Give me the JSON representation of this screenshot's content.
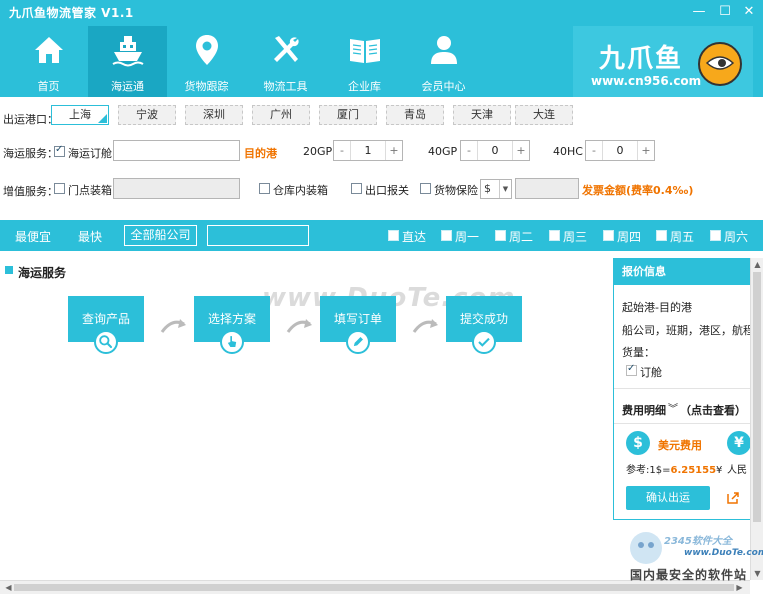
{
  "app": {
    "title": "九爪鱼物流管家 V1.1"
  },
  "window_controls": {
    "minimize": "—",
    "maximize": "☐",
    "close": "✕"
  },
  "nav": [
    {
      "label": "首页",
      "icon": "home-icon"
    },
    {
      "label": "海运通",
      "icon": "ship-icon",
      "active": true
    },
    {
      "label": "货物跟踪",
      "icon": "location-pin-icon"
    },
    {
      "label": "物流工具",
      "icon": "tools-icon"
    },
    {
      "label": "企业库",
      "icon": "book-icon"
    },
    {
      "label": "会员中心",
      "icon": "user-icon"
    }
  ],
  "logo": {
    "name": "九爪鱼",
    "url": "www.cn956.com"
  },
  "ports": {
    "label": "出运港口：",
    "items": [
      "上海",
      "宁波",
      "深圳",
      "广州",
      "厦门",
      "青岛",
      "天津",
      "大连"
    ],
    "selected": "上海"
  },
  "sea_service": {
    "label": "海运服务：",
    "booking_label": "海运订舱",
    "booking_checked": true,
    "destination_label": "目的港",
    "containers": [
      {
        "type": "20GP",
        "value": "1"
      },
      {
        "type": "40GP",
        "value": "0"
      },
      {
        "type": "40HC",
        "value": "0"
      }
    ],
    "minus": "-",
    "plus": "+"
  },
  "value_added": {
    "label": "增值服务：",
    "door_pickup": "门点装箱",
    "warehouse_packing": "仓库内装箱",
    "export_declaration": "出口报关",
    "cargo_insurance": "货物保险",
    "currency": "$",
    "invoice_label": "发票金额(费率0.4‰)"
  },
  "filter_bar": {
    "cheapest": "最便宜",
    "fastest": "最快",
    "all_carriers": "全部船公司",
    "days": [
      "直达",
      "周一",
      "周二",
      "周三",
      "周四",
      "周五",
      "周六"
    ]
  },
  "main": {
    "section_title": "海运服务",
    "watermark": "www.DuoTe.com",
    "steps": [
      {
        "label": "查询产品",
        "icon": "search-icon"
      },
      {
        "label": "选择方案",
        "icon": "hand-pointer-icon"
      },
      {
        "label": "填写订单",
        "icon": "pen-icon"
      },
      {
        "label": "提交成功",
        "icon": "check-icon"
      }
    ]
  },
  "quote": {
    "title": "报价信息",
    "route": "起始港-目的港",
    "details": "船公司，班期，港区，航程，",
    "cargo_label": "货量：",
    "booking": "订舱",
    "fee_detail": "费用明细",
    "click_view": "（点击查看）",
    "usd_label": "美元费用",
    "usd_symbol": "$",
    "cny_symbol": "¥",
    "cny_label": "人民",
    "rate_prefix": "参考:1$=",
    "rate_value": "6.25155",
    "rate_suffix": "¥",
    "confirm": "确认出运"
  },
  "corner_brand": {
    "url": "www.DuoTe.com",
    "text": "国内最安全的软件站",
    "badge": "2345软件大全"
  }
}
